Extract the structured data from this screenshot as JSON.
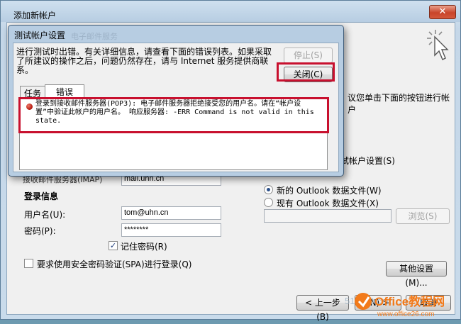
{
  "outer_window": {
    "title": "添加新帐户",
    "close_glyph": "✕",
    "instruction_suffix": "议您单击下面的按钮进行帐户",
    "test_settings_suffix": "试帐户设置(S)",
    "partial_field_label": "接收邮件服务器(IMAP)",
    "partial_field_value": "mail.uhn.cn",
    "login_section_title": "登录信息",
    "username_label": "用户名(U):",
    "username_value": "tom@uhn.cn",
    "password_label": "密码(P):",
    "password_value": "********",
    "remember_password_label": "记住密码(R)",
    "spa_label": "要求使用安全密码验证(SPA)进行登录(Q)",
    "new_outlook_file_label": "新的 Outlook 数据文件(W)",
    "existing_outlook_file_label": "现有 Outlook 数据文件(X)",
    "browse_button": "浏览(S)",
    "more_settings_button": "其他设置(M)...",
    "back_button": "< 上一步(B)",
    "next_button_partial": "(N) >",
    "cancel_button_partial": "取消"
  },
  "dialog": {
    "title": "测试帐户设置",
    "ghost_title": "电子邮件服务",
    "message": "进行测试时出错。有关详细信息，请查看下面的错误列表。如果采取了所建议的操作之后，问题仍然存在，请与 Internet 服务提供商联系。",
    "stop_button": "停止(S)",
    "close_button": "关闭(C)",
    "tabs": [
      {
        "label": "任务"
      },
      {
        "label": "错误"
      }
    ],
    "error_message": "登录到接收邮件服务器(POP3): 电子邮件服务器拒绝接受您的用户名。请在“帐户设置”中验证此帐户的用户名。  响应服务器: -ERR Command is not valid in this state."
  },
  "watermark": {
    "site_prefix": "51CTO.com",
    "brand": "Office教程网",
    "url": "www.office26.com"
  },
  "colors": {
    "highlight_red": "#c8102e",
    "brand_orange": "#f27a1a"
  }
}
